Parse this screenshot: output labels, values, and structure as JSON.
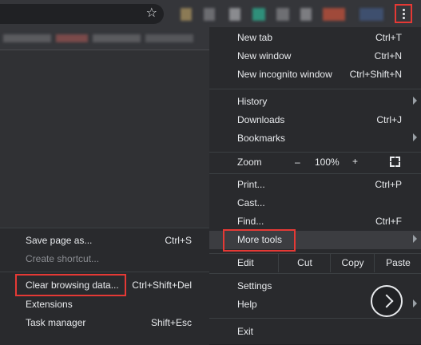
{
  "menu": {
    "new_tab": {
      "label": "New tab",
      "shortcut": "Ctrl+T"
    },
    "new_window": {
      "label": "New window",
      "shortcut": "Ctrl+N"
    },
    "new_incognito": {
      "label": "New incognito window",
      "shortcut": "Ctrl+Shift+N"
    },
    "history": {
      "label": "History"
    },
    "downloads": {
      "label": "Downloads",
      "shortcut": "Ctrl+J"
    },
    "bookmarks": {
      "label": "Bookmarks"
    },
    "zoom": {
      "label": "Zoom",
      "minus": "–",
      "value": "100%",
      "plus": "+"
    },
    "print": {
      "label": "Print...",
      "shortcut": "Ctrl+P"
    },
    "cast": {
      "label": "Cast..."
    },
    "find": {
      "label": "Find...",
      "shortcut": "Ctrl+F"
    },
    "more_tools": {
      "label": "More tools"
    },
    "edit": {
      "label": "Edit",
      "cut": "Cut",
      "copy": "Copy",
      "paste": "Paste"
    },
    "settings": {
      "label": "Settings"
    },
    "help": {
      "label": "Help"
    },
    "exit": {
      "label": "Exit"
    }
  },
  "submenu": {
    "save_page": {
      "label": "Save page as...",
      "shortcut": "Ctrl+S"
    },
    "create_shortcut": {
      "label": "Create shortcut..."
    },
    "clear_browsing": {
      "label": "Clear browsing data...",
      "shortcut": "Ctrl+Shift+Del"
    },
    "extensions": {
      "label": "Extensions"
    },
    "task_manager": {
      "label": "Task manager",
      "shortcut": "Shift+Esc"
    }
  },
  "colors": {
    "highlight_box": "#e53935",
    "menu_bg": "#292a2d",
    "hover_bg": "#3c3d41"
  }
}
